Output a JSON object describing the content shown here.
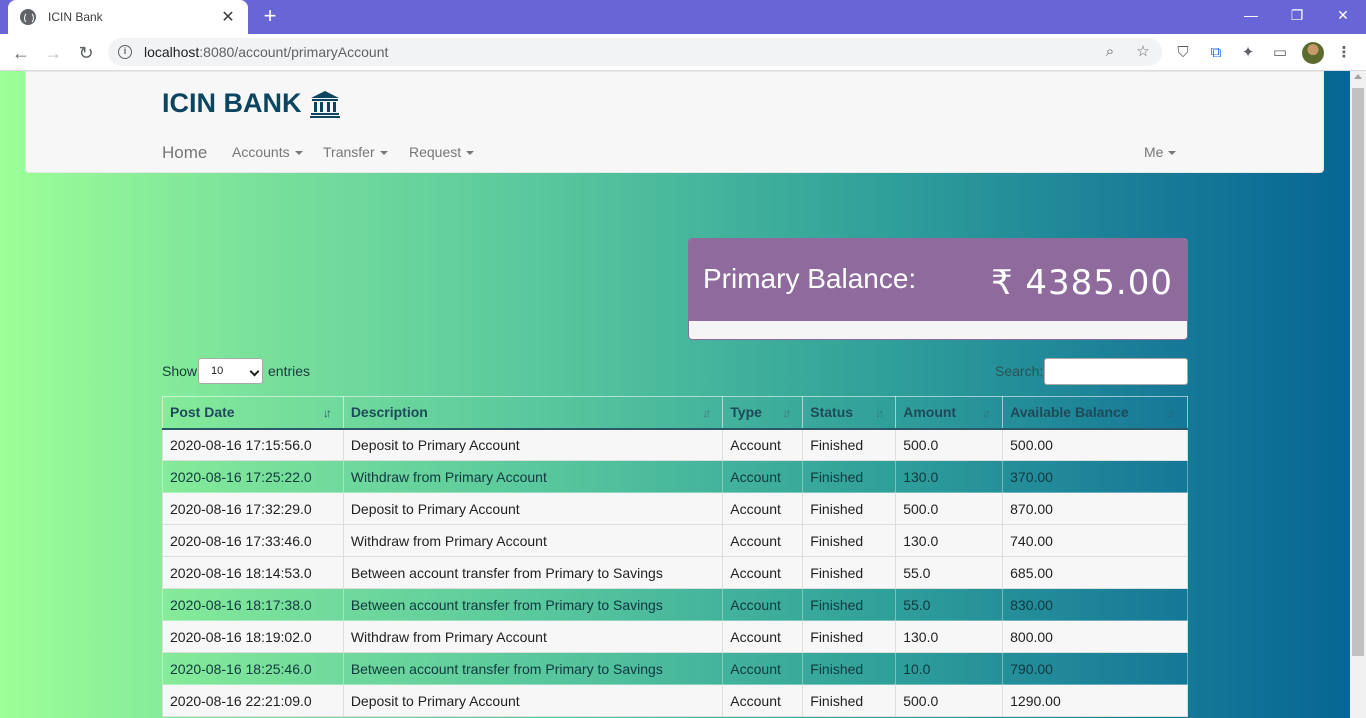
{
  "browser": {
    "tab_title": "ICIN Bank",
    "url_host": "localhost",
    "url_path": ":8080/account/primaryAccount"
  },
  "app": {
    "brand": "ICIN BANK",
    "nav": {
      "home": "Home",
      "accounts": "Accounts",
      "transfer": "Transfer",
      "request": "Request",
      "me": "Me"
    }
  },
  "balance": {
    "label": "Primary Balance:",
    "value": "₹ 4385.00"
  },
  "table_controls": {
    "show_label": "Show",
    "length_value": "10",
    "entries_label": "entries",
    "search_label": "Search:",
    "search_value": ""
  },
  "table": {
    "columns": [
      "Post Date",
      "Description",
      "Type",
      "Status",
      "Amount",
      "Available Balance"
    ],
    "rows": [
      [
        "2020-08-16 17:15:56.0",
        "Deposit to Primary Account",
        "Account",
        "Finished",
        "500.0",
        "500.00"
      ],
      [
        "2020-08-16 17:25:22.0",
        "Withdraw from Primary Account",
        "Account",
        "Finished",
        "130.0",
        "370.00"
      ],
      [
        "2020-08-16 17:32:29.0",
        "Deposit to Primary Account",
        "Account",
        "Finished",
        "500.0",
        "870.00"
      ],
      [
        "2020-08-16 17:33:46.0",
        "Withdraw from Primary Account",
        "Account",
        "Finished",
        "130.0",
        "740.00"
      ],
      [
        "2020-08-16 18:14:53.0",
        "Between account transfer from Primary to Savings",
        "Account",
        "Finished",
        "55.0",
        "685.00"
      ],
      [
        "2020-08-16 18:17:38.0",
        "Between account transfer from Primary to Savings",
        "Account",
        "Finished",
        "55.0",
        "830.00"
      ],
      [
        "2020-08-16 18:19:02.0",
        "Withdraw from Primary Account",
        "Account",
        "Finished",
        "130.0",
        "800.00"
      ],
      [
        "2020-08-16 18:25:46.0",
        "Between account transfer from Primary to Savings",
        "Account",
        "Finished",
        "10.0",
        "790.00"
      ],
      [
        "2020-08-16 22:21:09.0",
        "Deposit to Primary Account",
        "Account",
        "Finished",
        "500.0",
        "1290.00"
      ]
    ]
  },
  "colors": {
    "browser_frame": "#6866d6",
    "brand": "#0b4560",
    "balance_card": "#8e6a9d"
  }
}
